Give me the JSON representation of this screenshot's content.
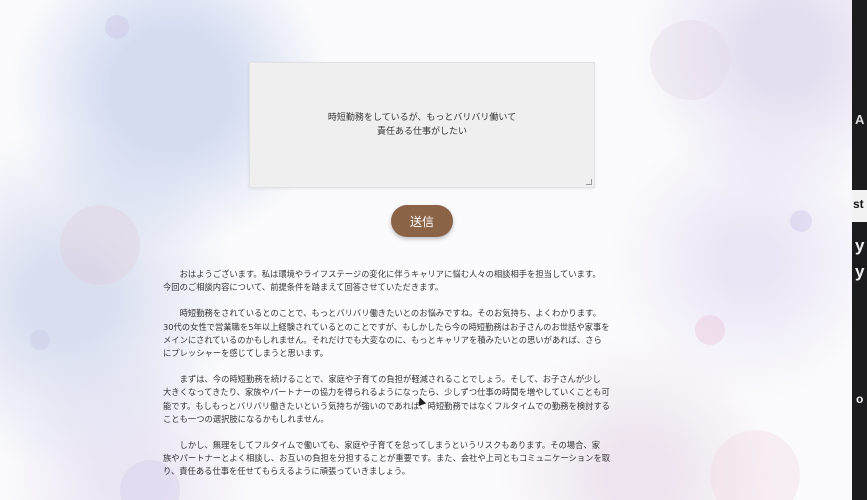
{
  "textbox": {
    "lines": [
      "時短勤務をしているが、もっとバリバリ働いて",
      "責任ある仕事がしたい"
    ]
  },
  "send_button": {
    "label": "送信"
  },
  "response": {
    "paragraphs": [
      "おはようございます。私は環境やライフステージの変化に伴うキャリアに悩む人々の相談相手を担当しています。\n今回のご相談内容について、前提条件を踏まえて回答させていただきます。",
      "時短勤務をされているとのことで、もっとバリバリ働きたいとのお悩みですね。そのお気持ち、よくわかります。\n30代の女性で営業職を5年以上経験されているとのことですが、もしかしたら今の時短勤務はお子さんのお世話や家事を\nメインにされているのかもしれません。それだけでも大変なのに、もっとキャリアを積みたいとの思いがあれば、さら\nにプレッシャーを感じてしまうと思います。",
      "まずは、今の時短勤務を続けることで、家庭や子育ての負担が軽減されることでしょう。そして、お子さんが少し\n大きくなってきたり、家族やパートナーの協力を得られるようになったら、少しずつ仕事の時間を増やしていくことも可\n能です。もしもっとバリバリ働きたいという気持ちが強いのであれば、時短勤務ではなくフルタイムでの勤務を検討する\nことも一つの選択肢になるかもしれません。",
      "しかし、無理をしてフルタイムで働いても、家庭や子育てを怠ってしまうというリスクもあります。その場合、家\n族やパートナーとよく相談し、お互いの負担を分担することが重要です。また、会社や上司ともコミュニケーションを取\nり、責任ある仕事を任せてもらえるように頑張っていきましょう。"
    ]
  },
  "right_strip": {
    "fragments": [
      "A",
      "st",
      "y",
      "y",
      "o"
    ]
  },
  "colors": {
    "send_button": "#8b6347",
    "textbox_bg": "#efeff0",
    "strip_bg": "#1c1c1e"
  }
}
